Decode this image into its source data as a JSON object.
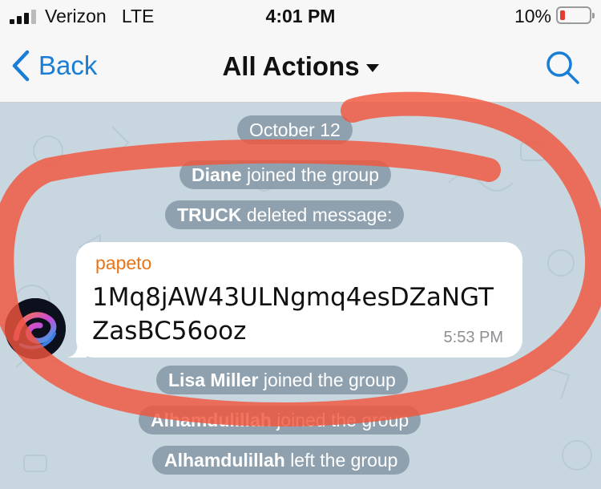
{
  "status_bar": {
    "carrier": "Verizon",
    "network": "LTE",
    "time": "4:01 PM",
    "battery_percent": "10%",
    "battery_level": 0.1,
    "battery_color": "#e63b2e"
  },
  "nav": {
    "back_label": "Back",
    "title": "All Actions",
    "accent_color": "#1a7ed6"
  },
  "chat": {
    "date_label": "October 12",
    "events_top": [
      {
        "actor": "Diane",
        "action": "joined the group"
      },
      {
        "actor": "TRUCK",
        "action": "deleted message:"
      }
    ],
    "message": {
      "sender": "papeto",
      "text": "1Mq8jAW43ULNgmq4esDZaNGTZasBC56ooz",
      "time": "5:53 PM"
    },
    "events_bottom": [
      {
        "actor": "Lisa Miller",
        "action": "joined the group"
      },
      {
        "actor": "Alhamdulillah",
        "action": "joined the group"
      },
      {
        "actor": "Alhamdulillah",
        "action": "left the group"
      }
    ]
  },
  "annotation": {
    "color": "#f0553c"
  }
}
